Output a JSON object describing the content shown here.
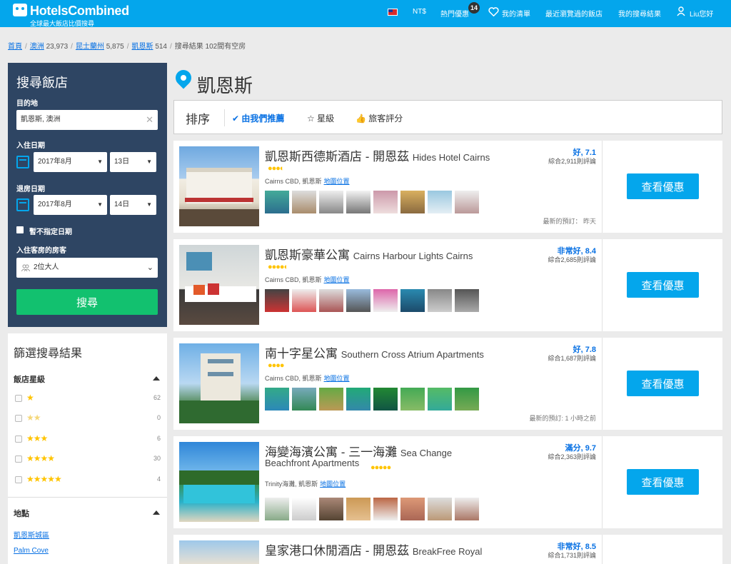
{
  "header": {
    "brand": "HotelsCombined",
    "tagline": "全球最大飯店比價搜尋",
    "currency": "NT$",
    "hot_deals": "熱門優惠",
    "hot_deals_count": "14",
    "wishlist": "我的清單",
    "recent": "最近瀏覽過的飯店",
    "my_search": "我的搜尋結果",
    "user": "Liu您好"
  },
  "breadcrumb": {
    "home": "首頁",
    "c1": "澳洲",
    "c1_count": "23,973",
    "c2": "昆士蘭州",
    "c2_count": "5,875",
    "c3": "凱恩斯",
    "c3_count": "514",
    "current": "搜尋結果 102間有空房"
  },
  "search": {
    "title": "搜尋飯店",
    "dest_label": "目的地",
    "dest_value": "凱恩斯, 澳洲",
    "checkin_label": "入住日期",
    "checkin_month": "2017年8月",
    "checkin_day": "13日",
    "checkout_label": "退房日期",
    "checkout_month": "2017年8月",
    "checkout_day": "14日",
    "no_date": "暫不指定日期",
    "guests_label": "入住客房的房客",
    "guests_value": "2位大人",
    "button": "搜尋"
  },
  "filter": {
    "title": "篩選搜尋結果",
    "stars_heading": "飯店星級",
    "star_rows": [
      {
        "stars": "★",
        "count": "62"
      },
      {
        "stars": "★★",
        "count": "0"
      },
      {
        "stars": "★★★",
        "count": "6"
      },
      {
        "stars": "★★★★",
        "count": "30"
      },
      {
        "stars": "★★★★★",
        "count": "4"
      }
    ],
    "location_heading": "地點",
    "locations": [
      "凱恩斯城區",
      "Palm Cove"
    ]
  },
  "results": {
    "city": "凱恩斯",
    "sort_label": "排序",
    "sort_options": [
      "由我們推薦",
      "星級",
      "旅客評分"
    ]
  },
  "hotels": [
    {
      "name": "凱恩斯西德斯酒店 - 開恩茲",
      "name_en": "Hides Hotel Cairns",
      "stars": "●●●◐",
      "location": "Cairns CBD, 凱恩斯",
      "map": "地圖位置",
      "score": "好, 7.1",
      "reviews": "綜合2,911則評論",
      "last": "最新的預訂： 昨天",
      "deal": "查看優惠"
    },
    {
      "name": "凱恩斯豪華公寓",
      "name_en": "Cairns Harbour Lights Cairns",
      "stars": "●●●●◐",
      "location": "Cairns CBD, 凱恩斯",
      "map": "地圖位置",
      "score": "非常好, 8.4",
      "reviews": "綜合2,685則評論",
      "last": "",
      "deal": "查看優惠"
    },
    {
      "name": "南十字星公寓",
      "name_en": "Southern Cross Atrium Apartments",
      "stars": "●●●●",
      "location": "Cairns CBD, 凱恩斯",
      "map": "地圖位置",
      "score": "好, 7.8",
      "reviews": "綜合1,687則評論",
      "last": "最新的預訂: 1 小時之前",
      "deal": "查看優惠"
    },
    {
      "name": "海變海濱公寓 - 三一海灘",
      "name_en": "Sea Change",
      "name_en2": "Beachfront Apartments",
      "stars": "●●●●●",
      "location": "Trinity海灘, 凱恩斯",
      "map": "地圖位置",
      "score": "滿分, 9.7",
      "reviews": "綜合2,363則評論",
      "last": "",
      "deal": "查看優惠"
    },
    {
      "name": "皇家港口休閒酒店 - 開恩茲",
      "name_en": "BreakFree Royal",
      "score": "非常好, 8.5",
      "reviews": "綜合1,731則評論"
    }
  ]
}
